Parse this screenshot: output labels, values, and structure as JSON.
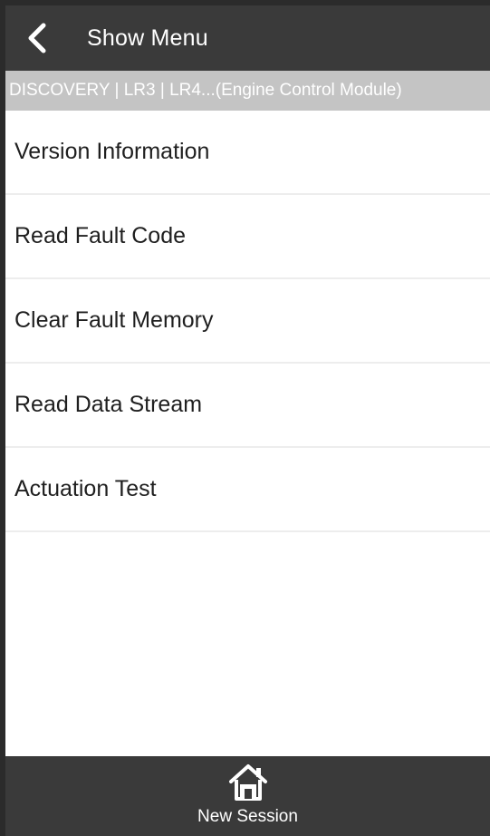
{
  "header": {
    "title": "Show Menu",
    "back_icon": "chevron-left-icon"
  },
  "breadcrumb": "DISCOVERY | LR3 | LR4...(Engine Control Module)",
  "menu": {
    "items": [
      {
        "label": "Version Information"
      },
      {
        "label": "Read Fault Code"
      },
      {
        "label": "Clear Fault Memory"
      },
      {
        "label": "Read Data Stream"
      },
      {
        "label": "Actuation Test"
      }
    ]
  },
  "footer": {
    "icon": "home-icon",
    "label": "New Session"
  },
  "colors": {
    "bar_background": "#3a3a3a",
    "breadcrumb_background": "#c4c4c4",
    "text": "#1f1f1f"
  }
}
